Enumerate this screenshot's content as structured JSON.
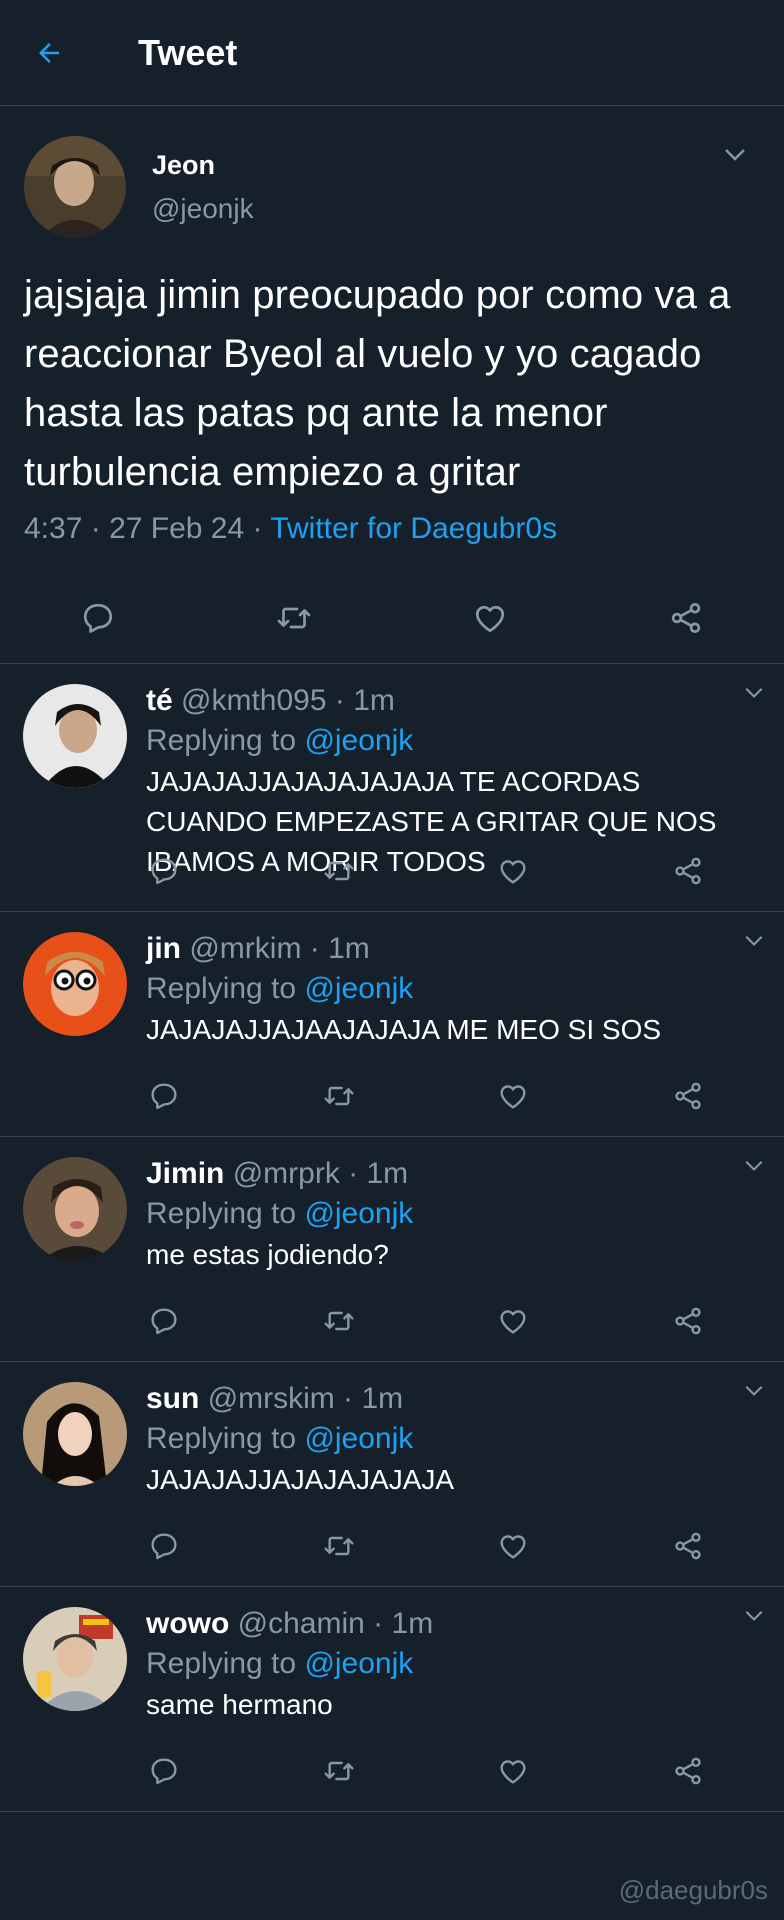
{
  "header": {
    "title": "Tweet"
  },
  "tweet": {
    "name": "Jeon",
    "handle": "@jeonjk",
    "text": "jajsjaja jimin preocupado por como va a reaccionar Byeol al vuelo y yo cagado hasta las patas pq ante la menor turbulencia empiezo a gritar",
    "time": "4:37",
    "date": "27 Feb 24",
    "app": "Twitter for Daegubr0s"
  },
  "replies": [
    {
      "name": "té",
      "handle": "@kmth095",
      "time": "1m",
      "replying": "Replying to",
      "to": "@jeonjk",
      "text": "JAJAJAJJAJAJAJAJAJA TE ACORDAS CUANDO EMPEZASTE A GRITAR QUE NOS IBAMOS A MORIR TODOS"
    },
    {
      "name": "jin",
      "handle": "@mrkim",
      "time": "1m",
      "replying": "Replying to",
      "to": "@jeonjk",
      "text": "JAJAJAJJAJAAJAJAJA ME MEO SI SOS"
    },
    {
      "name": "Jimin",
      "handle": "@mrprk",
      "time": "1m",
      "replying": "Replying to",
      "to": "@jeonjk",
      "text": "me estas jodiendo?"
    },
    {
      "name": "sun",
      "handle": "@mrskim",
      "time": "1m",
      "replying": "Replying to",
      "to": "@jeonjk",
      "text": "JAJAJAJJAJAJAJAJAJA"
    },
    {
      "name": "wowo",
      "handle": "@chamin",
      "time": "1m",
      "replying": "Replying to",
      "to": "@jeonjk",
      "text": "same hermano"
    }
  ],
  "watermark": "@daegubr0s",
  "colors": {
    "background": "#15202b",
    "accent": "#1da1f2",
    "muted": "#8899a6",
    "divider": "#38444d"
  },
  "icons": [
    "back-arrow-icon",
    "chevron-down-icon",
    "reply-icon",
    "retweet-icon",
    "like-icon",
    "share-icon"
  ]
}
